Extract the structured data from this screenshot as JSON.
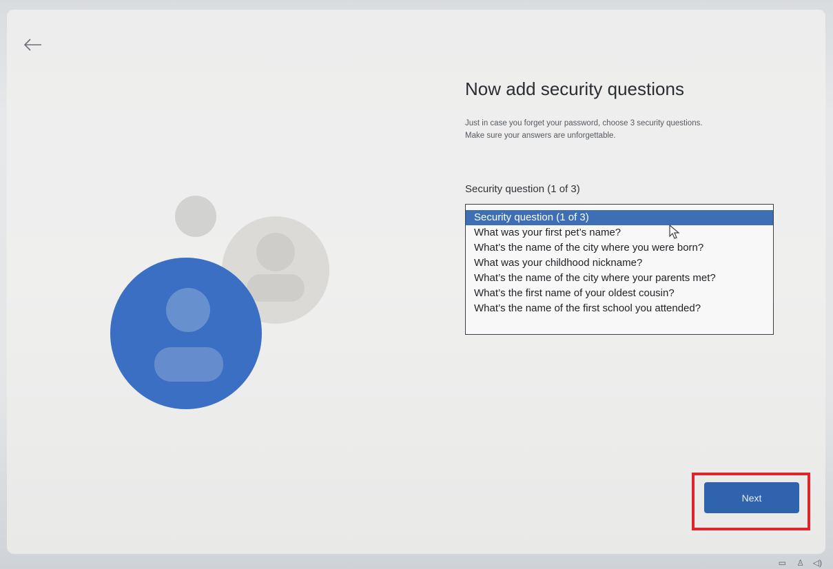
{
  "page": {
    "title": "Now add security questions",
    "description_lines": [
      "Just in case you forget your password, choose 3 security questions.",
      "Make sure your answers are unforgettable."
    ],
    "field_label": "Security question (1 of 3)"
  },
  "dropdown": {
    "selected_index": 0,
    "options": [
      "Security question (1 of 3)",
      "What was your first pet’s name?",
      "What’s the name of the city where you were born?",
      "What was your childhood nickname?",
      "What’s the name of the city where your parents met?",
      "What’s the first name of your oldest cousin?",
      "What’s the name of the first school you attended?"
    ]
  },
  "actions": {
    "next_label": "Next",
    "back_icon": "arrow-left-icon"
  },
  "colors": {
    "accent": "#2f63ad",
    "selected_option": "#3e6eb4",
    "highlight": "#e0242c",
    "avatar_blue": "#3a6fc4"
  }
}
